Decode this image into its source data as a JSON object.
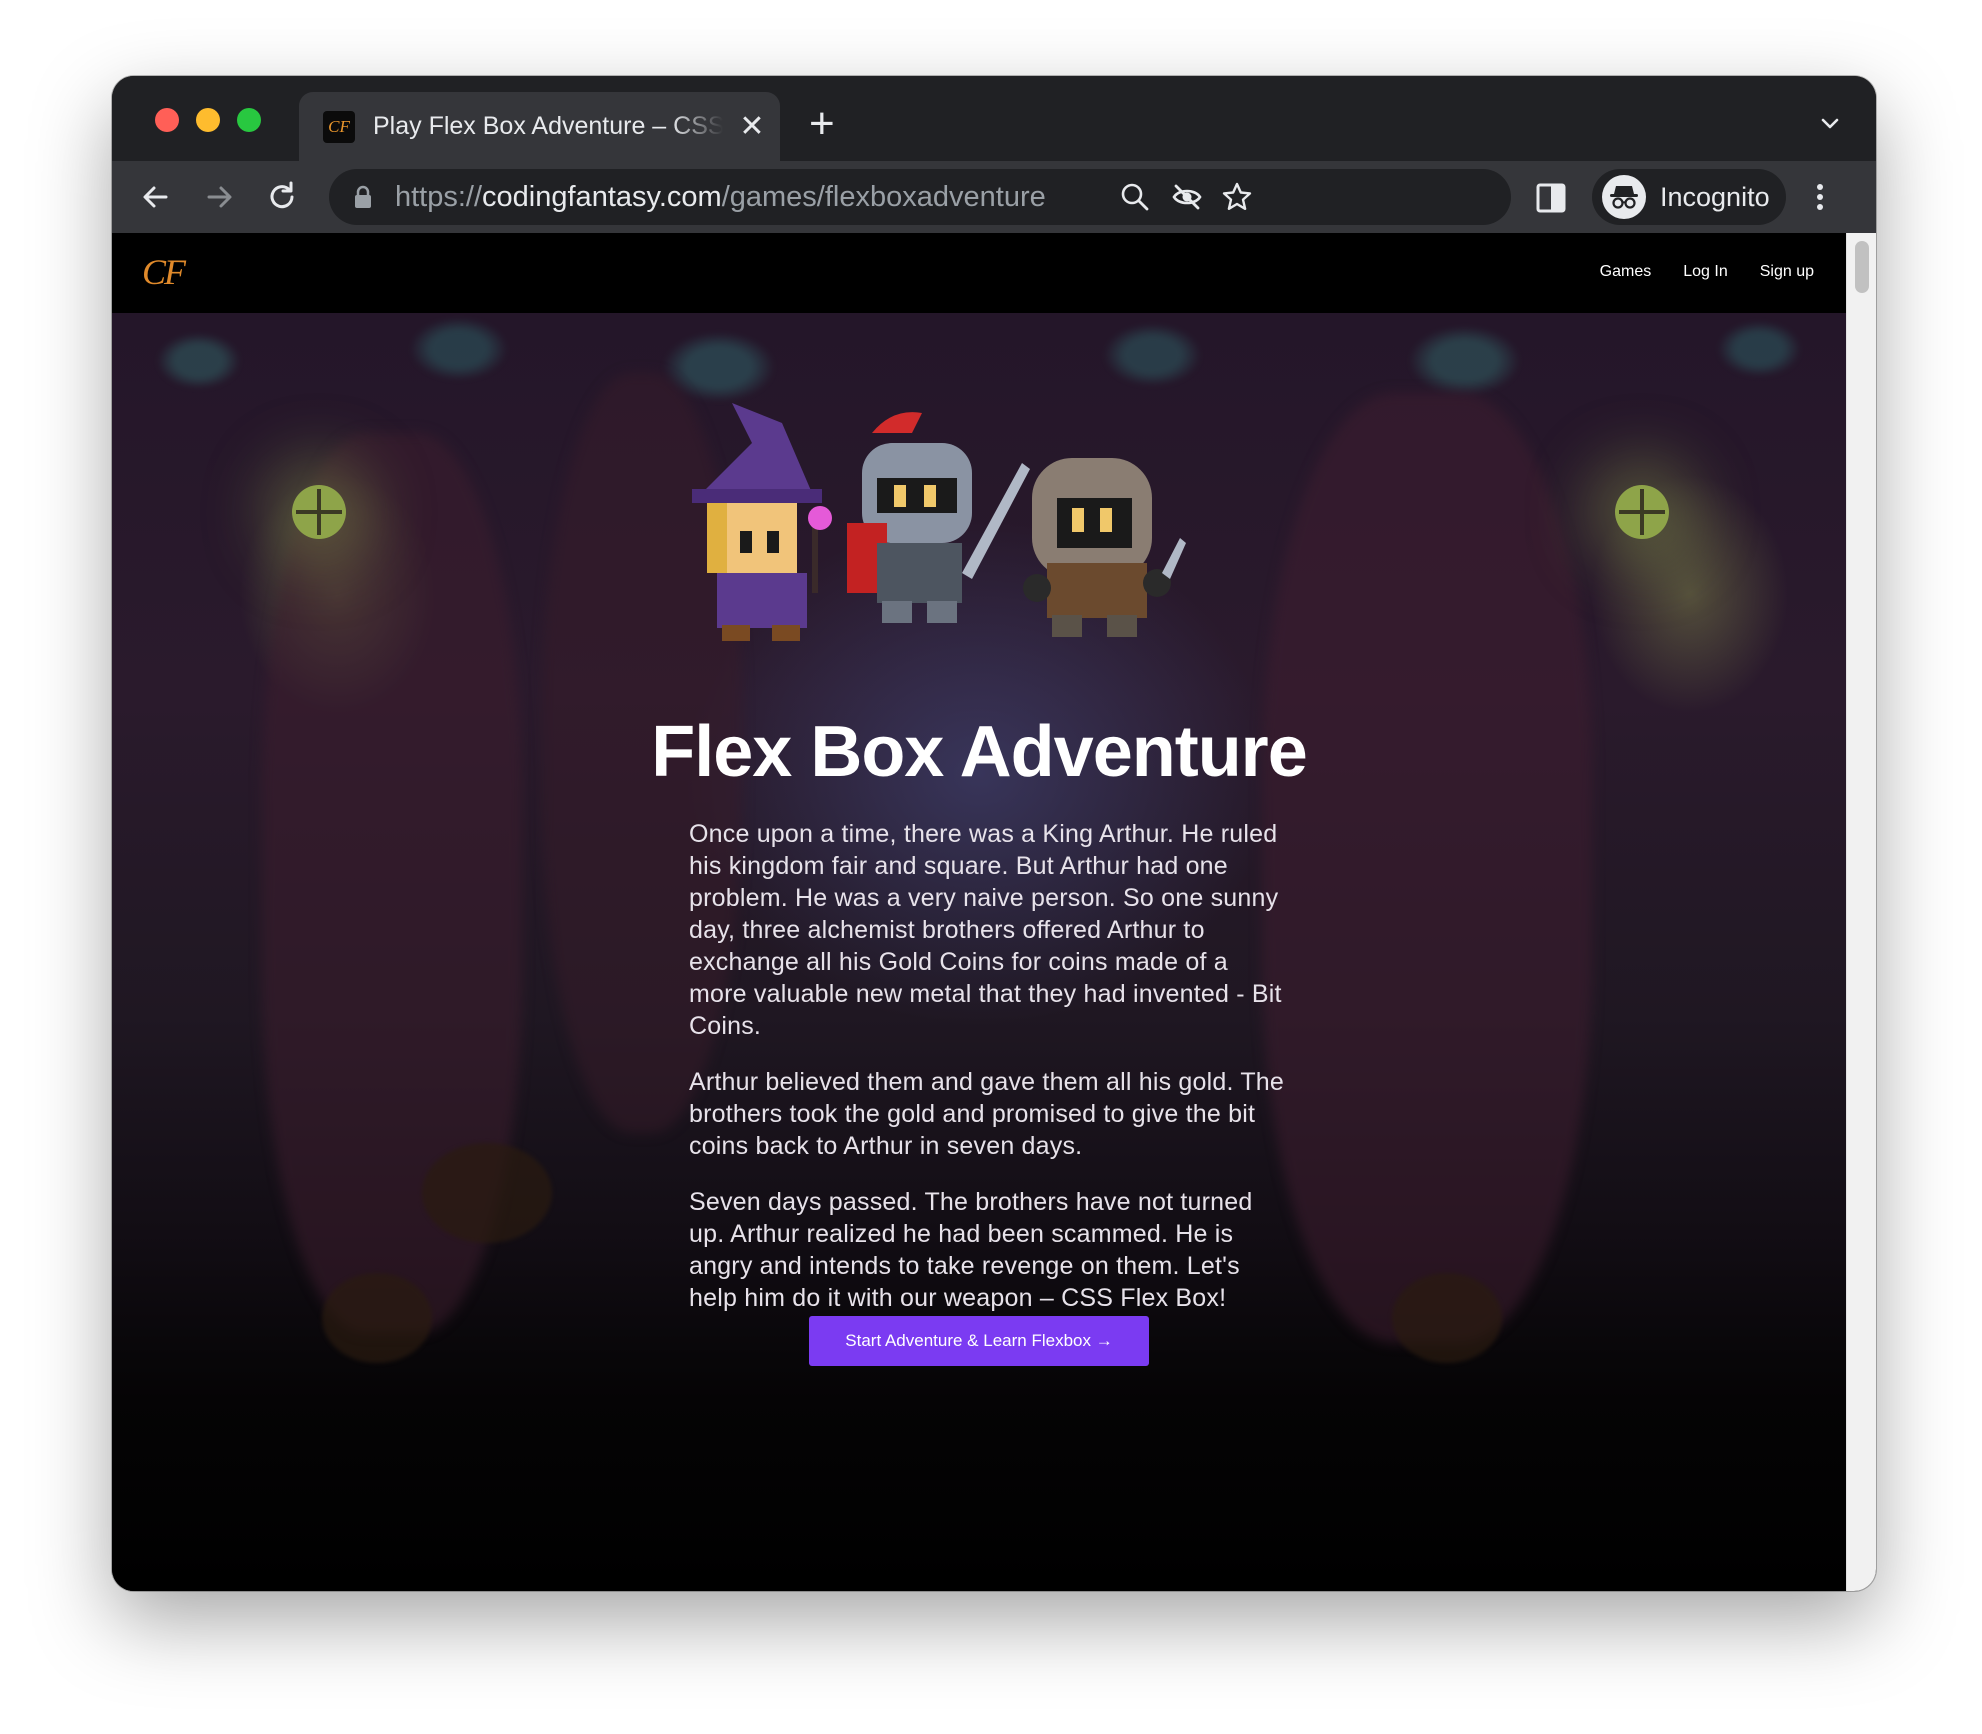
{
  "browser": {
    "tab_title": "Play Flex Box Adventure – CSS",
    "tab_favicon_text": "CF",
    "tab_close": "✕",
    "new_tab": "+",
    "url_scheme": "https://",
    "url_host": "codingfantasy.com",
    "url_path": "/games/flexboxadventure",
    "profile_label": "Incognito"
  },
  "site": {
    "logo": "CF",
    "nav": {
      "games": "Games",
      "login": "Log In",
      "signup": "Sign up"
    }
  },
  "hero": {
    "title": "Flex Box Adventure",
    "paragraphs": [
      "Once upon a time, there was a King Arthur. He ruled his kingdom fair and square. But Arthur had one problem. He was a very naive person. So one sunny day, three alchemist brothers offered Arthur to exchange all his Gold Coins for coins made of a more valuable new metal that they had invented - Bit Coins.",
      "Arthur believed them and gave them all his gold. The brothers took the gold and promised to give the bit coins back to Arthur in seven days.",
      "Seven days passed. The brothers have not turned up. Arthur realized he had been scammed. He is angry and intends to take revenge on them. Let's help him do it with our weapon – CSS Flex Box!"
    ],
    "cta_label": "Start Adventure & Learn Flexbox →"
  },
  "colors": {
    "accent": "#7b3bf2",
    "logo": "#e08a2b",
    "chrome_dark": "#202124",
    "chrome_tab": "#35363a"
  }
}
